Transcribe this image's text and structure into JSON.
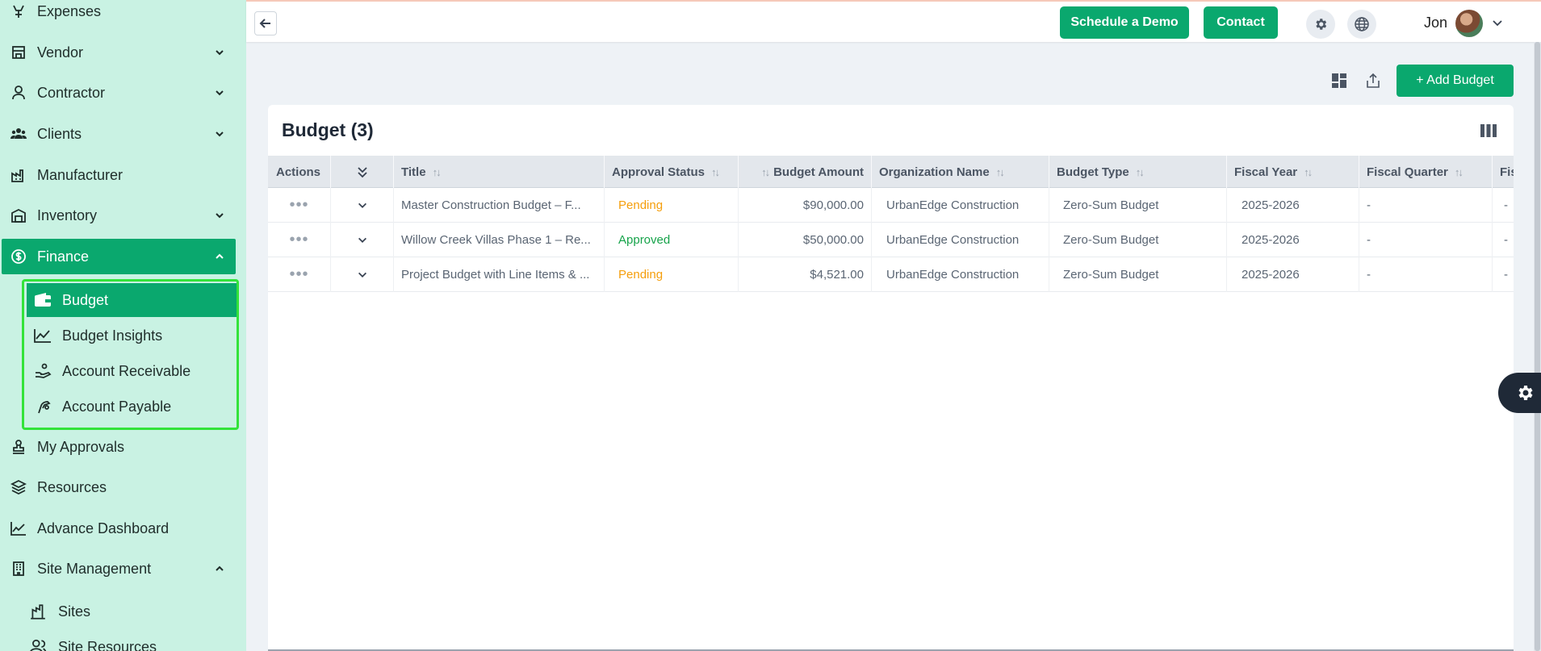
{
  "sidebar": {
    "items": [
      {
        "label": "Expenses",
        "icon": "expenses-icon"
      },
      {
        "label": "Vendor",
        "icon": "store-icon"
      },
      {
        "label": "Contractor",
        "icon": "person-icon"
      },
      {
        "label": "Clients",
        "icon": "users-icon"
      },
      {
        "label": "Manufacturer",
        "icon": "factory-icon"
      },
      {
        "label": "Inventory",
        "icon": "warehouse-icon"
      },
      {
        "label": "Finance",
        "icon": "dollar-circle-icon"
      },
      {
        "label": "My Approvals",
        "icon": "stamp-icon"
      },
      {
        "label": "Resources",
        "icon": "layers-icon"
      },
      {
        "label": "Advance Dashboard",
        "icon": "chart-line-icon"
      },
      {
        "label": "Site Management",
        "icon": "building-icon"
      }
    ],
    "finance_sub": [
      {
        "label": "Budget",
        "icon": "wallet-icon"
      },
      {
        "label": "Budget Insights",
        "icon": "trend-icon"
      },
      {
        "label": "Account Receivable",
        "icon": "hand-coin-icon"
      },
      {
        "label": "Account Payable",
        "icon": "hand-pay-icon"
      }
    ],
    "site_sub": [
      {
        "label": "Sites",
        "icon": "site-icon"
      },
      {
        "label": "Site Resources",
        "icon": "people-icon"
      }
    ]
  },
  "topbar": {
    "schedule_demo": "Schedule a Demo",
    "contact": "Contact",
    "user_name": "Jon"
  },
  "toolbar": {
    "add_budget": "+ Add Budget"
  },
  "card": {
    "title": "Budget (3)"
  },
  "table": {
    "headers": {
      "actions": "Actions",
      "title": "Title",
      "approval_status": "Approval Status",
      "budget_amount": "Budget Amount",
      "organization_name": "Organization Name",
      "budget_type": "Budget Type",
      "fiscal_year": "Fiscal Year",
      "fiscal_quarter": "Fiscal Quarter",
      "next": "Fis"
    },
    "rows": [
      {
        "title": "Master Construction Budget – F...",
        "status": "Pending",
        "amount": "$90,000.00",
        "org": "UrbanEdge Construction",
        "type": "Zero-Sum Budget",
        "year": "2025-2026",
        "quarter": "-",
        "next": "-"
      },
      {
        "title": "Willow Creek Villas Phase 1 – Re...",
        "status": "Approved",
        "amount": "$50,000.00",
        "org": "UrbanEdge Construction",
        "type": "Zero-Sum Budget",
        "year": "2025-2026",
        "quarter": "-",
        "next": "-"
      },
      {
        "title": "Project Budget with Line Items & ...",
        "status": "Pending",
        "amount": "$4,521.00",
        "org": "UrbanEdge Construction",
        "type": "Zero-Sum Budget",
        "year": "2025-2026",
        "quarter": "-",
        "next": "-"
      }
    ]
  },
  "colors": {
    "accent": "#0aa86e",
    "sidebar_bg": "#c9f2e3",
    "pending": "#f59e0b",
    "approved": "#16a34a",
    "highlight": "#33e33a"
  }
}
